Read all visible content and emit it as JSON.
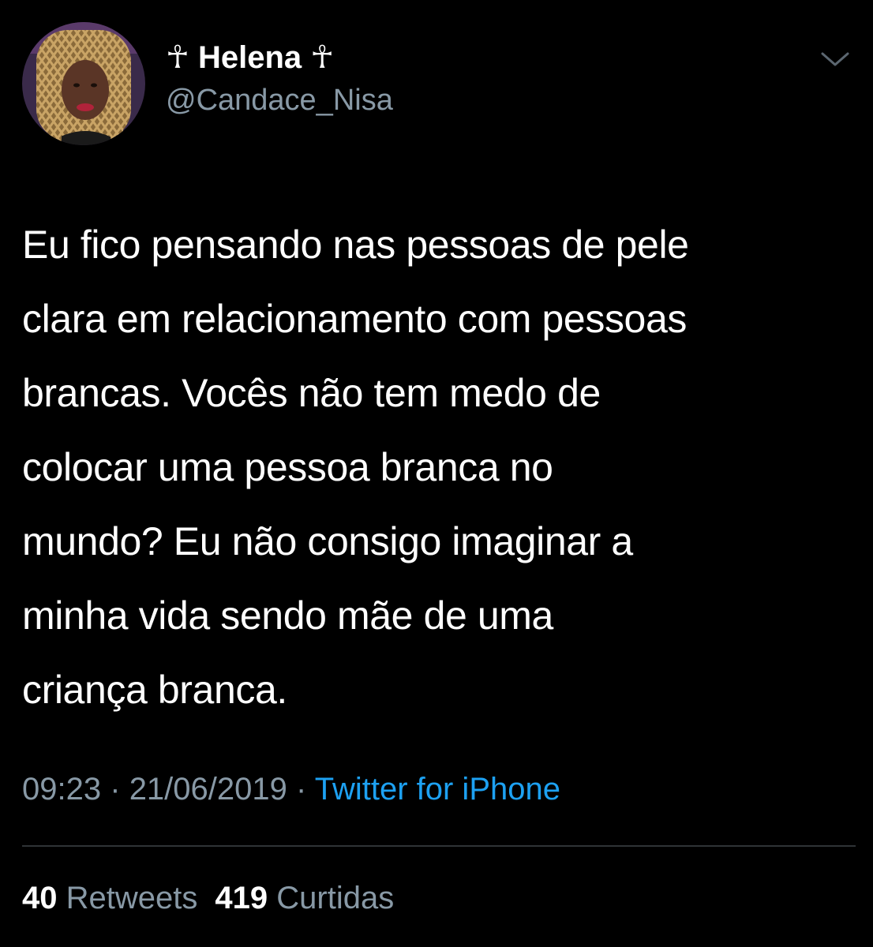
{
  "tweet": {
    "display_name": "☥ Helena ☥",
    "handle": "@Candace_Nisa",
    "text": "Eu fico pensando nas pessoas de pele\nclara em relacionamento com pessoas\nbrancas. Vocês não tem medo de\ncolocar uma pessoa branca no\nmundo? Eu não consigo imaginar a\nminha vida sendo mãe de uma\ncriança branca.",
    "time": "09:23",
    "separator": "·",
    "date": "21/06/2019",
    "source": "Twitter for iPhone"
  },
  "stats": {
    "retweets_count": "40",
    "retweets_label": "Retweets",
    "likes_count": "419",
    "likes_label": "Curtidas"
  },
  "icons": {
    "menu": "chevron-down-icon"
  },
  "colors": {
    "background": "#000000",
    "text_primary": "#ffffff",
    "text_secondary": "#8899a6",
    "link": "#1da1f2",
    "divider": "#2f3336"
  }
}
